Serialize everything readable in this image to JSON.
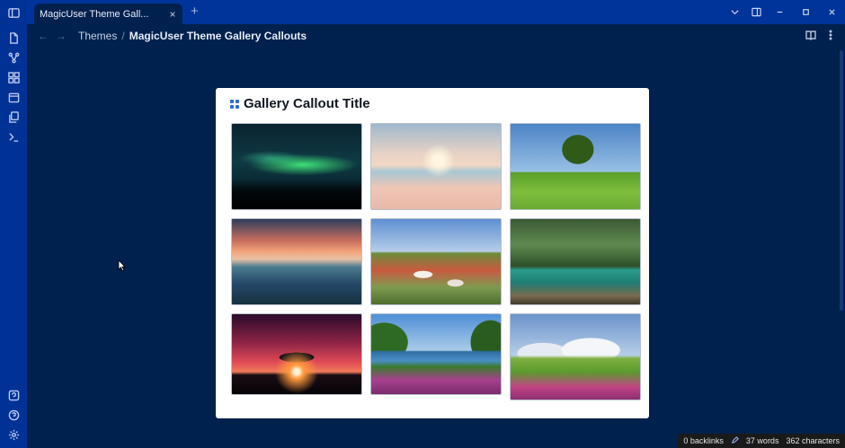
{
  "tab": {
    "title": "MagicUser Theme Gall...",
    "close_glyph": "×",
    "new_glyph": "+"
  },
  "ribbon": {
    "icons": [
      "sidebar-toggle-icon",
      "files-icon",
      "graph-icon",
      "canvas-icon",
      "calendar-icon",
      "copy-icon",
      "terminal-icon",
      "help-chat-icon",
      "help-icon",
      "settings-icon"
    ]
  },
  "nav": {
    "back_glyph": "←",
    "forward_glyph": "→",
    "crumb_parent": "Themes",
    "crumb_separator": "/",
    "crumb_current": "MagicUser Theme Gallery Callouts"
  },
  "callout": {
    "title": "Gallery Callout Title",
    "images": [
      {
        "name": "aurora-night-sky-image"
      },
      {
        "name": "sunrise-beach-image"
      },
      {
        "name": "lone-tree-field-image"
      },
      {
        "name": "cloudy-sunset-sea-image"
      },
      {
        "name": "village-aerial-image"
      },
      {
        "name": "forest-river-image"
      },
      {
        "name": "red-sky-tree-image"
      },
      {
        "name": "lake-flowers-image"
      },
      {
        "name": "snow-mountain-meadow-image"
      }
    ]
  },
  "status": {
    "backlinks": "0 backlinks",
    "words": "37 words",
    "characters": "362 characters"
  },
  "colors": {
    "ribbon": "#003296",
    "background": "#00214d",
    "accent": "#2a6cd0"
  }
}
